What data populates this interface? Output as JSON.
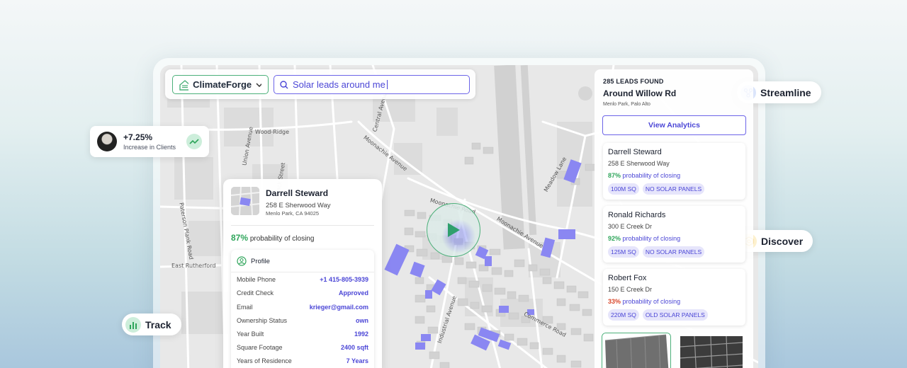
{
  "colors": {
    "accent": "#4b46d6",
    "brand_green": "#2ea55a",
    "warning_red": "#d9472b",
    "solar_panel": "#8a87f2"
  },
  "top_bar": {
    "brand_name": "ClimateForge",
    "search_value": "Solar leads around me"
  },
  "stat": {
    "value": "+7.25%",
    "label": "Increase in Clients"
  },
  "pills": {
    "streamline": "Streamline",
    "discover": "Discover",
    "track": "Track"
  },
  "map_labels": {
    "wood_ridge": "Wood-Ridge",
    "east_rutherford": "East Rutherford",
    "moonachie_1": "Moonachie Avenue",
    "moonachie_2": "Moonachie Road",
    "moonachie_3": "Moonachie Avenue",
    "commerce": "Commerce Road",
    "paterson": "Paterson Plank Road",
    "hackensack": "Hackensack Street",
    "union": "Union Avenue",
    "central": "Central Avenue",
    "industrial": "Industrial Avenue",
    "meadow": "Meadow Lane"
  },
  "detail": {
    "name": "Darrell Steward",
    "address": "258 E Sherwood Way",
    "city": "Menlo Park, CA 94025",
    "probability_pct": "87%",
    "probability_label": "probability of closing",
    "profile_title": "Profile",
    "rows": [
      {
        "label": "Mobile Phone",
        "value": "+1 415-805-3939"
      },
      {
        "label": "Credit Check",
        "value": "Approved"
      },
      {
        "label": "Email",
        "value": "krieger@gmail.com"
      },
      {
        "label": "Ownership Status",
        "value": "own"
      },
      {
        "label": "Year Built",
        "value": "1992"
      },
      {
        "label": "Square Footage",
        "value": "2400 sqft"
      },
      {
        "label": "Years of Residence",
        "value": "7 Years"
      }
    ]
  },
  "results": {
    "count": "285 LEADS FOUND",
    "title": "Around Willow Rd",
    "subtitle": "Menlo Park, Palo Alto",
    "analytics_button": "View Analytics",
    "leads": [
      {
        "name": "Darrell Steward",
        "address": "258 E Sherwood Way",
        "probability": "87%",
        "probability_label": "probability of closing",
        "tags": [
          "100M SQ",
          "NO SOLAR PANELS"
        ]
      },
      {
        "name": "Ronald Richards",
        "address": "300 E Creek Dr",
        "probability": "92%",
        "probability_label": "probability of closing",
        "tags": [
          "125M SQ",
          "NO SOLAR PANELS"
        ]
      },
      {
        "name": "Robert Fox",
        "address": "150 E Creek Dr",
        "probability": "33%",
        "probability_label": "probability of closing",
        "tags": [
          "220M SQ",
          "OLD SOLAR PANELS"
        ]
      }
    ]
  }
}
